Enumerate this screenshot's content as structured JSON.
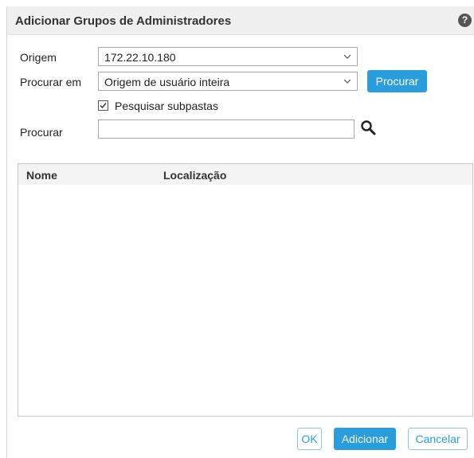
{
  "dialog": {
    "title": "Adicionar Grupos de Administradores",
    "help_glyph": "?"
  },
  "form": {
    "origem_label": "Origem",
    "origem_value": "172.22.10.180",
    "procurar_em_label": "Procurar em",
    "procurar_em_value": "Origem de usuário inteira",
    "procurar_button": "Procurar",
    "subfolders_label": "Pesquisar subpastas",
    "subfolders_checked": true,
    "search_label": "Procurar",
    "search_value": ""
  },
  "table": {
    "columns": [
      "Nome",
      "Localização"
    ],
    "rows": []
  },
  "footer": {
    "ok": "OK",
    "add": "Adicionar",
    "cancel": "Cancelar"
  },
  "colors": {
    "accent": "#2a9ddc",
    "titlebar": "#f0f0f0"
  }
}
